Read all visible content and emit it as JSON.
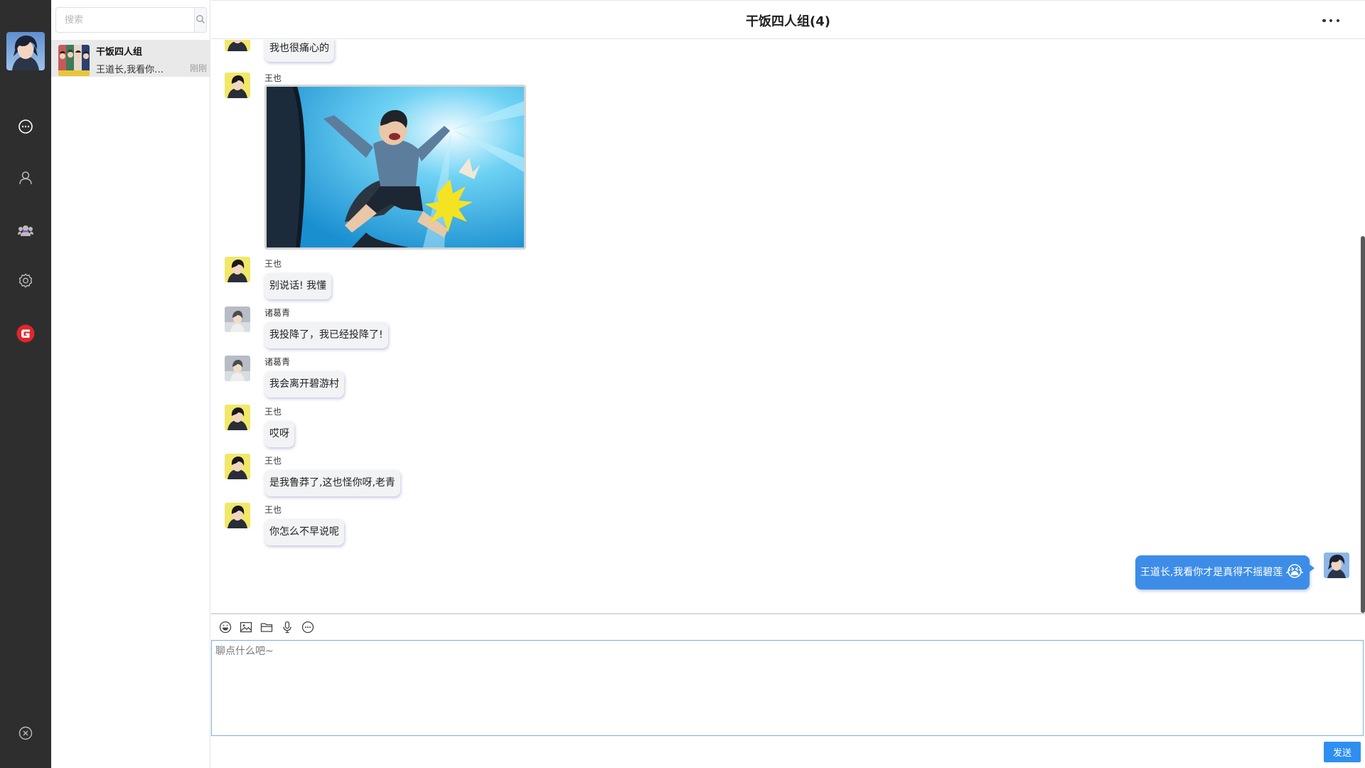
{
  "nav": {
    "icons": [
      "chat-icon",
      "contacts-icon",
      "groups-icon",
      "settings-icon",
      "game-logo-icon",
      "close-icon"
    ]
  },
  "search": {
    "placeholder": "搜索"
  },
  "sessions": [
    {
      "name": "干饭四人组",
      "preview": "王道长,我看你才是真得不摇碧莲",
      "time": "刚刚"
    }
  ],
  "chat": {
    "title": "干饭四人组(4)",
    "messages": [
      {
        "sender": "",
        "text": "我也很痛心的"
      },
      {
        "sender": "王也",
        "type": "image"
      },
      {
        "sender": "王也",
        "text": "别说话! 我懂"
      },
      {
        "sender": "诸葛青",
        "text": "我投降了，我已经投降了!"
      },
      {
        "sender": "诸葛青",
        "text": "我会离开碧游村"
      },
      {
        "sender": "王也",
        "text": "哎呀"
      },
      {
        "sender": "王也",
        "text": "是我鲁莽了,这也怪你呀,老青"
      },
      {
        "sender": "王也",
        "text": "你怎么不早说呢"
      }
    ],
    "own_message": {
      "text": "王道长,我看你才是真得不摇碧莲",
      "emoji": "😭"
    }
  },
  "composer": {
    "placeholder": "聊点什么吧~",
    "send_label": "发送",
    "tools": [
      "emoji-icon",
      "image-icon",
      "folder-icon",
      "microphone-icon",
      "chat-bubble-icon"
    ]
  },
  "colors": {
    "nav_bg": "#2e2e2e",
    "session_active": "#e9e9ea",
    "own_bubble": "#3d8de8",
    "send_button": "#2f8ff0",
    "accent_red": "#e0262b"
  }
}
